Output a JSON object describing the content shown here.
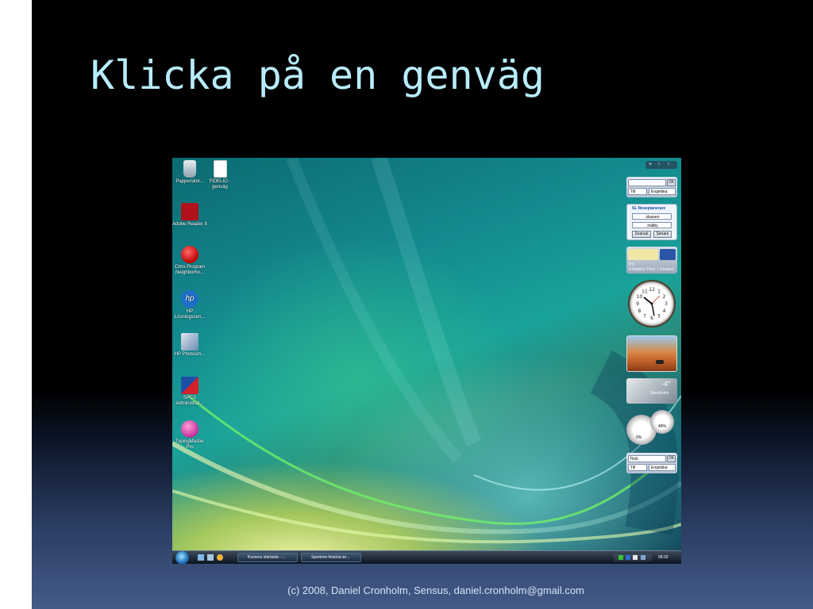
{
  "slide": {
    "title": "Klicka på en genväg",
    "footer": "(c) 2008, Daniel Cronholm, Sensus, daniel.cronholm@gmail.com",
    "accent_bars": [
      "#e0246e",
      "#4a5b78",
      "#f0a800",
      "#e0246e"
    ]
  },
  "desktop": {
    "icons": [
      {
        "label": "Papperskor...",
        "icon": "recycle-bin-icon"
      },
      {
        "label": "FIDELIO - genväg",
        "icon": "document-shortcut-icon"
      },
      {
        "label": "Adobe Reader 8",
        "icon": "adobe-reader-icon"
      },
      {
        "label": "Citrix Program Neighborho...",
        "icon": "citrix-icon"
      },
      {
        "label": "HP Lösningscen...",
        "icon": "hp-icon"
      },
      {
        "label": "HP Photosm...",
        "icon": "hp-photosmart-icon"
      },
      {
        "label": "SPCS Administrat...",
        "icon": "spcs-icon"
      },
      {
        "label": "TypingMaster Pro",
        "icon": "typingmaster-icon"
      }
    ],
    "sidebar": {
      "dict1": {
        "value": "",
        "ok": "OK",
        "dir": "Till",
        "lang": "Engelska"
      },
      "travel": {
        "title": "SL Reseplanerare",
        "from": "slussen",
        "to": "midby",
        "btn1": "Snarast",
        "btn2": "Senare"
      },
      "radio": {
        "label": "P3",
        "track": "d Martina Thun + Erasure"
      },
      "clock": {
        "numbers": [
          "12",
          "1",
          "2",
          "3",
          "4",
          "5",
          "6",
          "7",
          "8",
          "9",
          "10",
          "11"
        ]
      },
      "weather": {
        "temp": "-4°",
        "city": "Stockholm"
      },
      "meter": {
        "label1": "0%",
        "label2": "49%"
      },
      "dict2": {
        "value": "hus",
        "ok": "OK",
        "dir": "Till",
        "lang": "Engelska"
      }
    },
    "taskbar": {
      "tasks": [
        "Kursens startsida - ...",
        "Sportens historia se..."
      ],
      "time": "08:33"
    }
  }
}
